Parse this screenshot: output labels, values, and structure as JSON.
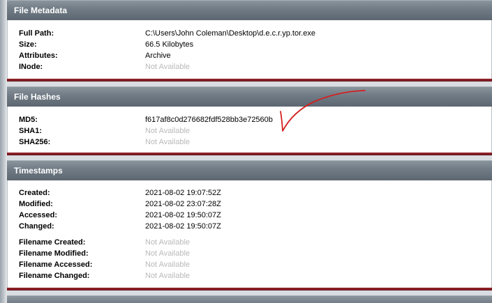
{
  "sections": {
    "metadata": {
      "title": "File Metadata",
      "rows": [
        {
          "label": "Full Path:",
          "value": "C:\\Users\\John Coleman\\Desktop\\d.e.c.r.yp.tor.exe"
        },
        {
          "label": "Size:",
          "value": "66.5 Kilobytes"
        },
        {
          "label": "Attributes:",
          "value": "Archive"
        },
        {
          "label": "INode:",
          "value": "Not Available"
        }
      ]
    },
    "hashes": {
      "title": "File Hashes",
      "rows": [
        {
          "label": "MD5:",
          "value": "f617af8c0d276682fdf528bb3e72560b"
        },
        {
          "label": "SHA1:",
          "value": "Not Available"
        },
        {
          "label": "SHA256:",
          "value": "Not Available"
        }
      ]
    },
    "timestamps": {
      "title": "Timestamps",
      "rows": [
        {
          "label": "Created:",
          "value": "2021-08-02 19:07:52Z"
        },
        {
          "label": "Modified:",
          "value": "2021-08-02 23:07:28Z"
        },
        {
          "label": "Accessed:",
          "value": "2021-08-02 19:50:07Z"
        },
        {
          "label": "Changed:",
          "value": "2021-08-02 19:50:07Z"
        },
        {
          "label": "Filename Created:",
          "value": "Not Available"
        },
        {
          "label": "Filename Modified:",
          "value": "Not Available"
        },
        {
          "label": "Filename Accessed:",
          "value": "Not Available"
        },
        {
          "label": "Filename Changed:",
          "value": "Not Available"
        }
      ]
    }
  },
  "colors": {
    "header_bg": "#6f7a84",
    "section_divider": "#8c1f26",
    "not_available_text": "#b9b9b9",
    "annotation_stroke": "#d42020"
  },
  "annotation": {
    "icon": "red-checkmark-icon"
  }
}
